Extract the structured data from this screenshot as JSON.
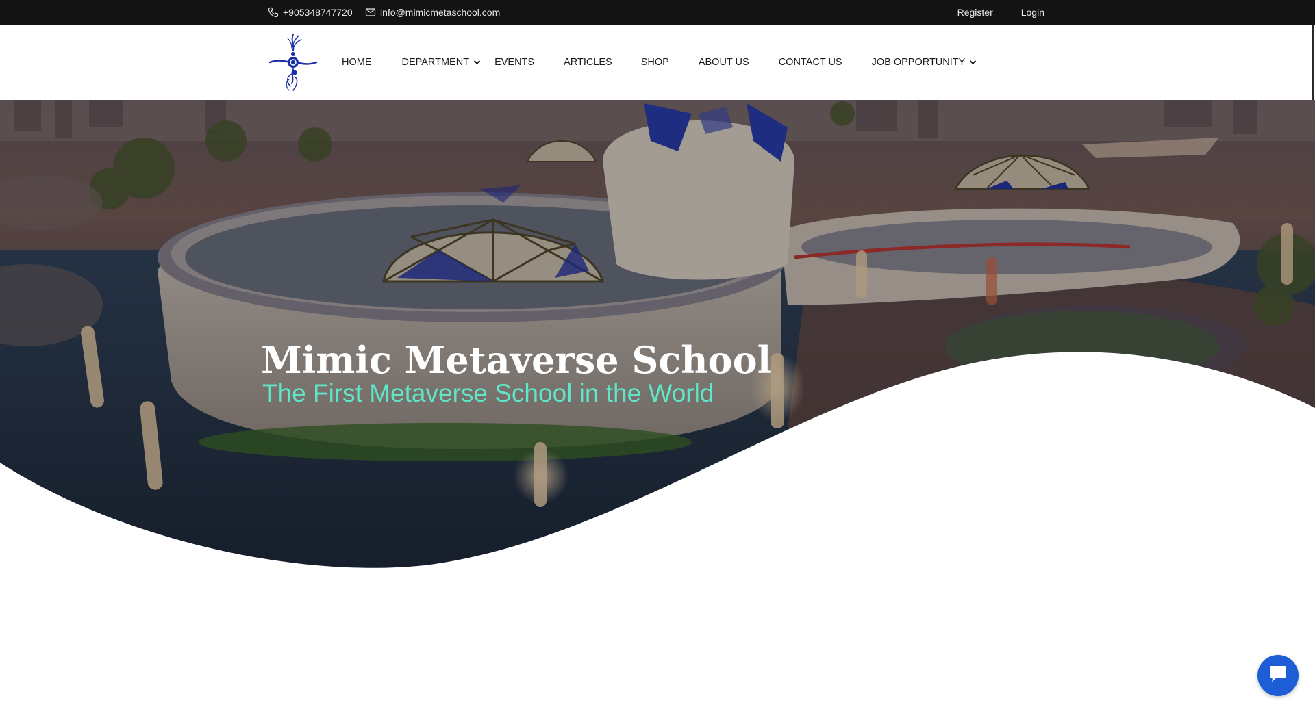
{
  "topbar": {
    "phone": "+905348747720",
    "email": "info@mimicmetaschool.com",
    "register_label": "Register",
    "login_label": "Login"
  },
  "nav": {
    "items": [
      {
        "label": "HOME",
        "has_dropdown": false
      },
      {
        "label": "DEPARTMENT",
        "has_dropdown": true
      },
      {
        "label": "EVENTS",
        "has_dropdown": false
      },
      {
        "label": "ARTICLES",
        "has_dropdown": false
      },
      {
        "label": "SHOP",
        "has_dropdown": false
      },
      {
        "label": "ABOUT US",
        "has_dropdown": false
      },
      {
        "label": "CONTACT US",
        "has_dropdown": false
      },
      {
        "label": "JOB OPPORTUNITY",
        "has_dropdown": true
      }
    ]
  },
  "hero": {
    "title": "Mimic Metaverse School",
    "subtitle": "The First Metaverse School in the World"
  },
  "icons": {
    "phone": "phone-icon",
    "email": "mail-icon",
    "chat": "chat-bubble-icon",
    "chevron": "chevron-down-icon"
  },
  "colors": {
    "topbar_bg": "#131313",
    "subtitle": "#5fe6c8",
    "chat_button": "#1d5ed6",
    "logo_blue": "#1b2fa8"
  }
}
